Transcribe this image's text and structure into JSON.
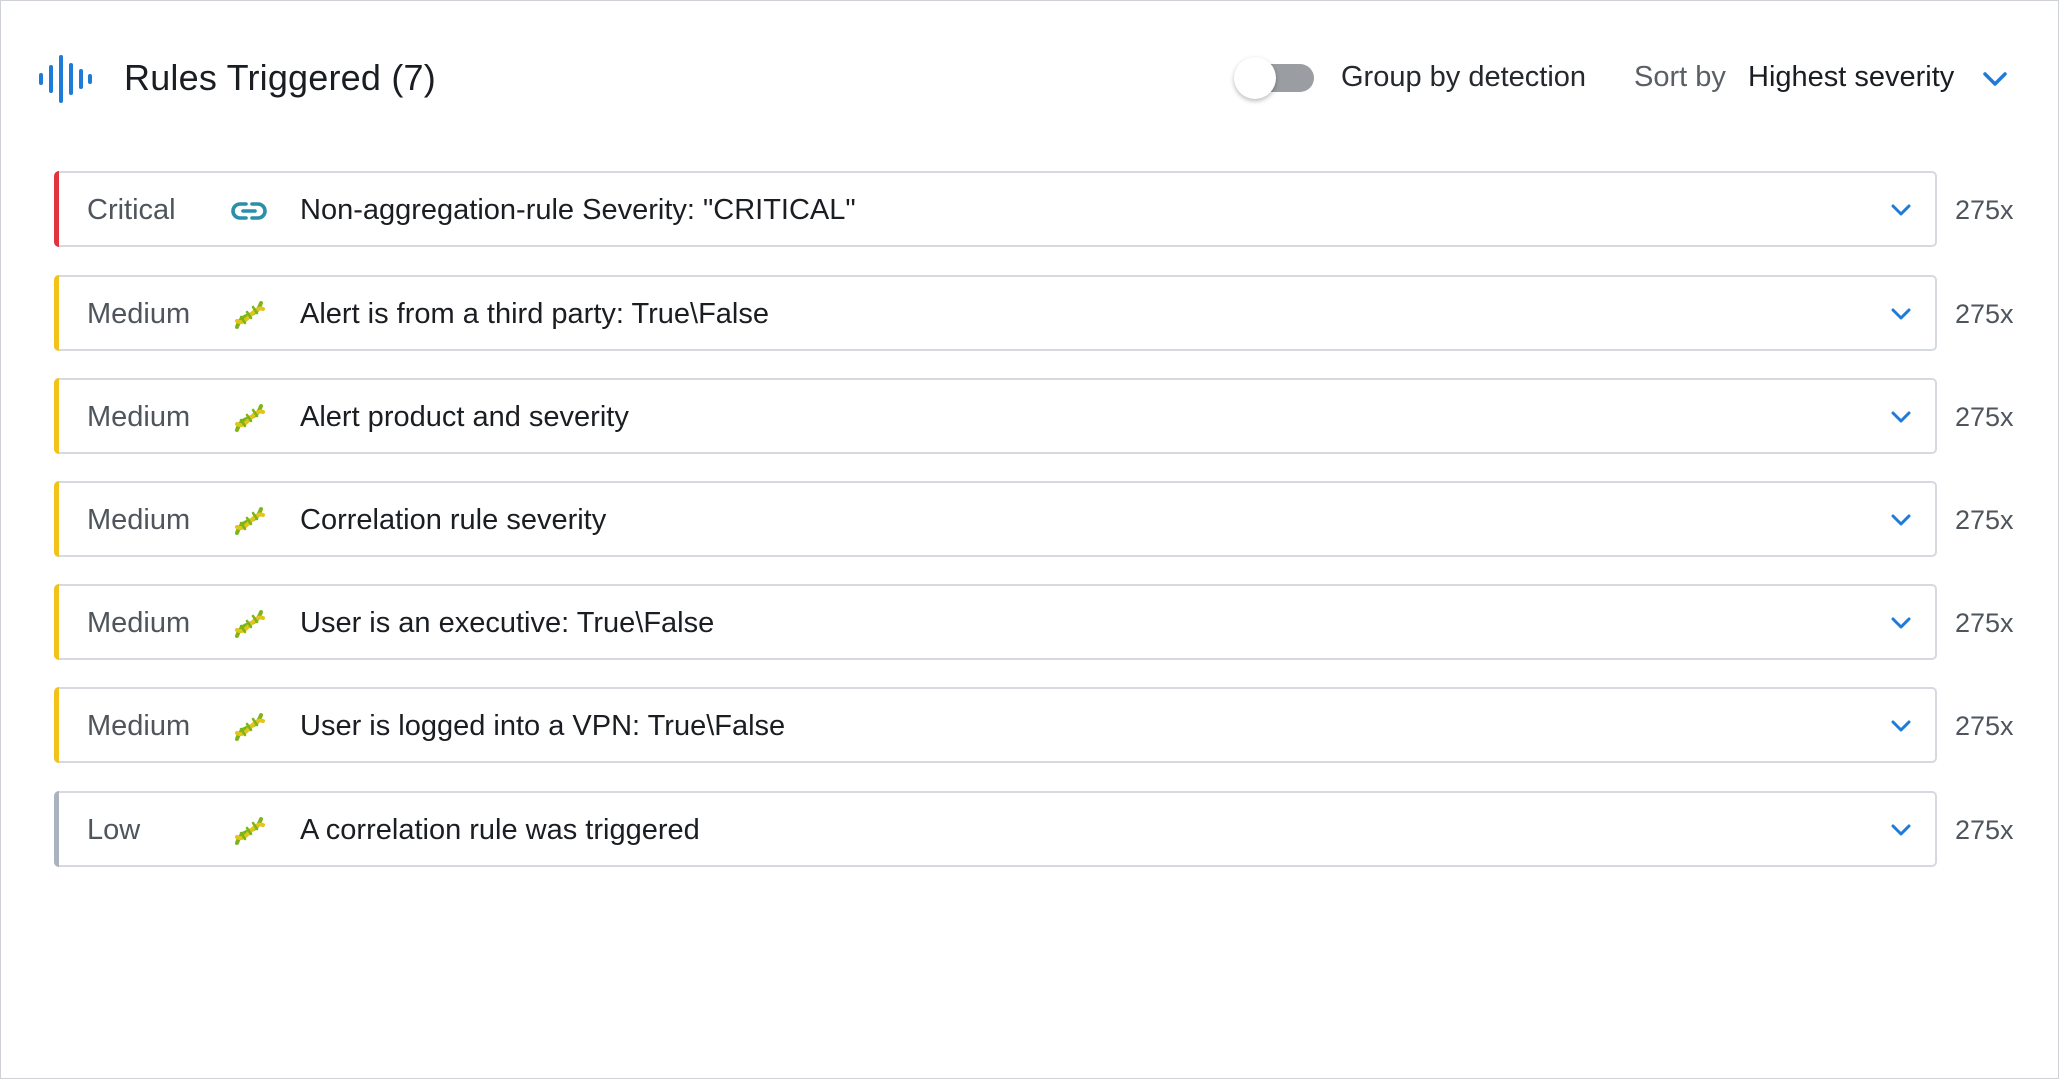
{
  "header": {
    "title": "Rules Triggered (7)",
    "icon": "audio-wave-icon",
    "group_by_label": "Group by detection",
    "group_by_enabled": false,
    "sort_label": "Sort by",
    "sort_value": "Highest severity"
  },
  "colors": {
    "accent": "#1f7bd8",
    "critical": "#e0343e",
    "medium": "#f2c21b",
    "low": "#a9b2bd",
    "link_icon": "#2a8fa8",
    "dna_icon_green": "#7cb518",
    "dna_icon_yellow": "#e3c41a"
  },
  "rules": [
    {
      "severity": "Critical",
      "icon": "link-icon",
      "name": "Non-aggregation-rule Severity: \"CRITICAL\"",
      "count": "275x"
    },
    {
      "severity": "Medium",
      "icon": "dna-icon",
      "name": "Alert is from a third party: True\\False",
      "count": "275x"
    },
    {
      "severity": "Medium",
      "icon": "dna-icon",
      "name": "Alert product and severity",
      "count": "275x"
    },
    {
      "severity": "Medium",
      "icon": "dna-icon",
      "name": "Correlation rule severity",
      "count": "275x"
    },
    {
      "severity": "Medium",
      "icon": "dna-icon",
      "name": "User is an executive: True\\False",
      "count": "275x"
    },
    {
      "severity": "Medium",
      "icon": "dna-icon",
      "name": "User is logged into a VPN: True\\False",
      "count": "275x"
    },
    {
      "severity": "Low",
      "icon": "dna-icon",
      "name": "A correlation rule was triggered",
      "count": "275x"
    }
  ]
}
